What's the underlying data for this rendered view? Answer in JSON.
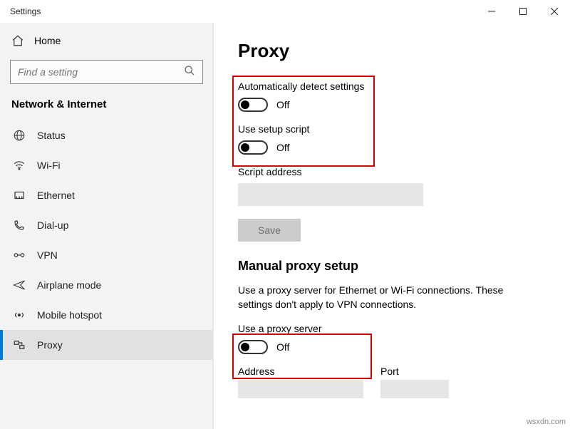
{
  "titlebar": {
    "app_title": "Settings"
  },
  "sidebar": {
    "home_label": "Home",
    "search_placeholder": "Find a setting",
    "category_title": "Network & Internet",
    "items": [
      {
        "label": "Status"
      },
      {
        "label": "Wi-Fi"
      },
      {
        "label": "Ethernet"
      },
      {
        "label": "Dial-up"
      },
      {
        "label": "VPN"
      },
      {
        "label": "Airplane mode"
      },
      {
        "label": "Mobile hotspot"
      },
      {
        "label": "Proxy"
      }
    ]
  },
  "content": {
    "page_title": "Proxy",
    "auto_detect_label": "Automatically detect settings",
    "auto_detect_state": "Off",
    "use_script_label": "Use setup script",
    "use_script_state": "Off",
    "script_address_label": "Script address",
    "save_label": "Save",
    "manual_heading": "Manual proxy setup",
    "manual_desc": "Use a proxy server for Ethernet or Wi-Fi connections. These settings don't apply to VPN connections.",
    "use_proxy_label": "Use a proxy server",
    "use_proxy_state": "Off",
    "address_label": "Address",
    "port_label": "Port"
  },
  "watermark": "wsxdn.com"
}
